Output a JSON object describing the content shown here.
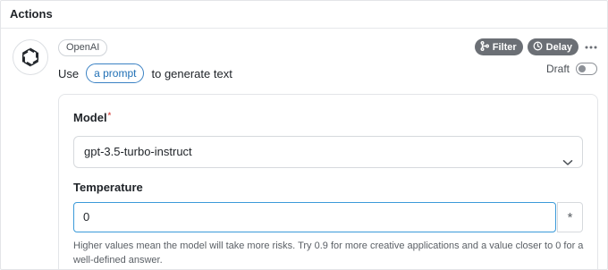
{
  "section": {
    "title": "Actions"
  },
  "step": {
    "provider": "OpenAI",
    "verb": "Use",
    "prompt_link": "a prompt",
    "action_suffix": "to generate text",
    "filter_label": "Filter",
    "delay_label": "Delay",
    "draft_label": "Draft",
    "draft_enabled": false
  },
  "config": {
    "model": {
      "label": "Model",
      "required_mark": "*",
      "selected": "gpt-3.5-turbo-instruct"
    },
    "temperature": {
      "label": "Temperature",
      "value": "0",
      "variable_button": "*",
      "help": "Higher values mean the model will take more risks. Try 0.9 for more creative applications and a value closer to 0 for a well-defined answer."
    }
  },
  "icons": {
    "logo": "openai-logo-icon",
    "filter": "branch-icon",
    "delay": "clock-icon",
    "more": "more-horizontal-icon",
    "select": "chevron-down-icon"
  },
  "colors": {
    "accent": "#3b9ad9",
    "pill": "#6b6f75",
    "link": "#1f6fb5"
  }
}
